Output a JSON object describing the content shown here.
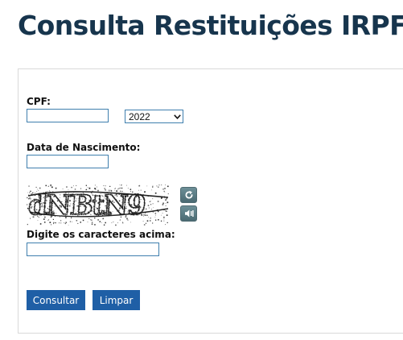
{
  "page": {
    "title": "Consulta Restituições IRPF"
  },
  "form": {
    "cpf": {
      "label": "CPF:",
      "value": ""
    },
    "year": {
      "selected": "2022"
    },
    "birth_date": {
      "label": "Data de Nascimento:",
      "value": ""
    },
    "captcha": {
      "image_text": "dNBtN9",
      "refresh_icon": "refresh-icon",
      "audio_icon": "audio-icon",
      "label": "Digite os caracteres acima:",
      "value": ""
    },
    "buttons": {
      "submit_label": "Consultar",
      "clear_label": "Limpar"
    }
  },
  "colors": {
    "title": "#17354d",
    "button": "#1f5fa6",
    "input_border": "#3f7fae",
    "icon_button": "#5c7d85"
  }
}
